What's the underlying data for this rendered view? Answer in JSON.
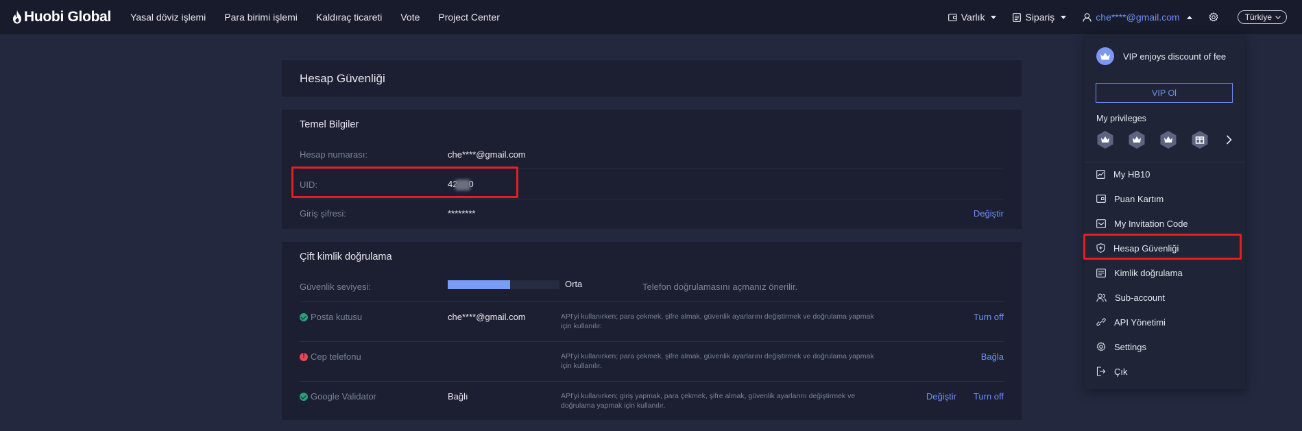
{
  "header": {
    "logo_text": "Huobi Global",
    "nav": [
      "Yasal döviz işlemi",
      "Para birimi işlemi",
      "Kaldıraç ticareti",
      "Vote",
      "Project Center"
    ],
    "assets_label": "Varlık",
    "orders_label": "Sipariş",
    "user_email": "che****@gmail.com",
    "language": "Türkiye"
  },
  "page": {
    "title": "Hesap Güvenliği"
  },
  "basic_info": {
    "title": "Temel Bilgiler",
    "account_label": "Hesap numarası:",
    "account_value": "che****@gmail.com",
    "uid_label": "UID:",
    "uid_prefix": "42",
    "uid_suffix": "0",
    "password_label": "Giriş şifresi:",
    "password_value": "********",
    "password_action": "Değiştir"
  },
  "two_factor": {
    "title": "Çift kimlik doğrulama",
    "security_label": "Güvenlik seviyesi:",
    "security_level_text": "Orta",
    "security_level_fraction": 0.56,
    "security_hint": "Telefon doğrulamasını açmanız önerilir.",
    "email_label": "Posta kutusu",
    "email_value": "che****@gmail.com",
    "email_desc": "API'yi kullanırken; para çekmek, şifre almak, güvenlik ayarlarını değiştirmek ve doğrulama yapmak için kullanılır.",
    "email_action": "Turn off",
    "phone_label": "Cep telefonu",
    "phone_desc": "API'yi kullanırken; para çekmek, şifre almak, güvenlik ayarlarını değiştirmek ve doğrulama yapmak için kullanılır.",
    "phone_action": "Bağla",
    "google_label": "Google Validator",
    "google_value": "Bağlı",
    "google_desc": "API'yi kullanırken; giriş yapmak, para çekmek, şifre almak, güvenlik ayarlarını değiştirmek ve doğrulama yapmak için kullanılır.",
    "google_action_change": "Değiştir",
    "google_action_off": "Turn off"
  },
  "dropdown": {
    "vip_text": "VIP enjoys discount of fee",
    "vip_button": "VIP Ol",
    "privileges_title": "My privileges",
    "menu": [
      "My HB10",
      "Puan Kartım",
      "My Invitation Code",
      "Hesap Güvenliği",
      "Kimlik doğrulama",
      "Sub-account",
      "API Yönetimi",
      "Settings",
      "Çık"
    ]
  },
  "colors": {
    "accent": "#6f8ff7",
    "highlight_box": "#e51f1f",
    "ok": "#26a17b",
    "warn": "#e5484d"
  }
}
